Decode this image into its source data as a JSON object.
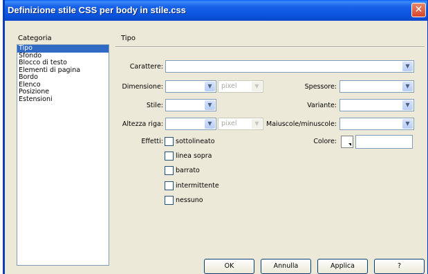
{
  "window": {
    "title": "Definizione stile CSS per body in stile.css",
    "close_glyph": "✕"
  },
  "category": {
    "label": "Categoria",
    "items": [
      "Tipo",
      "Sfondo",
      "Blocco di testo",
      "Elementi di pagina",
      "Bordo",
      "Elenco",
      "Posizione",
      "Estensioni"
    ],
    "selected": "Tipo"
  },
  "section": {
    "title": "Tipo"
  },
  "fields": {
    "carattere": {
      "label": "Carattere:",
      "value": ""
    },
    "dimensione": {
      "label": "Dimensione:",
      "value": "",
      "unit": "pixel"
    },
    "spessore": {
      "label": "Spessore:",
      "value": ""
    },
    "stile": {
      "label": "Stile:",
      "value": ""
    },
    "variante": {
      "label": "Variante:",
      "value": ""
    },
    "altezza": {
      "label": "Altezza riga:",
      "value": "",
      "unit": "pixel"
    },
    "maiuscole": {
      "label": "Maiuscole/minuscole:",
      "value": ""
    },
    "effetti": {
      "label": "Effetti:"
    },
    "colore": {
      "label": "Colore:",
      "value": ""
    }
  },
  "effects": [
    "sottolineato",
    "linea sopra",
    "barrato",
    "intermittente",
    "nessuno"
  ],
  "buttons": {
    "ok": "OK",
    "annulla": "Annulla",
    "applica": "Applica",
    "help": "?"
  },
  "icons": {
    "dropdown": "▼"
  }
}
